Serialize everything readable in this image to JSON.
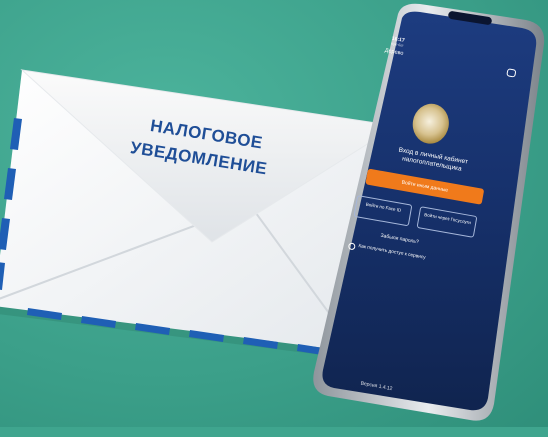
{
  "envelope": {
    "line1": "НАЛОГОВОЕ",
    "line2": "УВЕДОМЛЕНИЕ"
  },
  "phone": {
    "status_time": "16:17",
    "status_sub": "Кукі-бот",
    "back_label": "Дерево",
    "welcome_text": "Вход в личный кабинет налогоплательщика",
    "login_button": "Войти иным данные",
    "alt_login_1": "Войти по Face ID",
    "alt_login_2": "Войти через Госуслуги",
    "forgot_link": "Забыли пароль?",
    "help_link": "Как получить доступ к сервису",
    "version": "Версия 1.4.12"
  },
  "colors": {
    "background": "#3fa58e",
    "envelope_text": "#1f4e97",
    "envelope_stripe": "#1f5fb5",
    "phone_screen": "#16306a",
    "login_button": "#f07a1b"
  }
}
